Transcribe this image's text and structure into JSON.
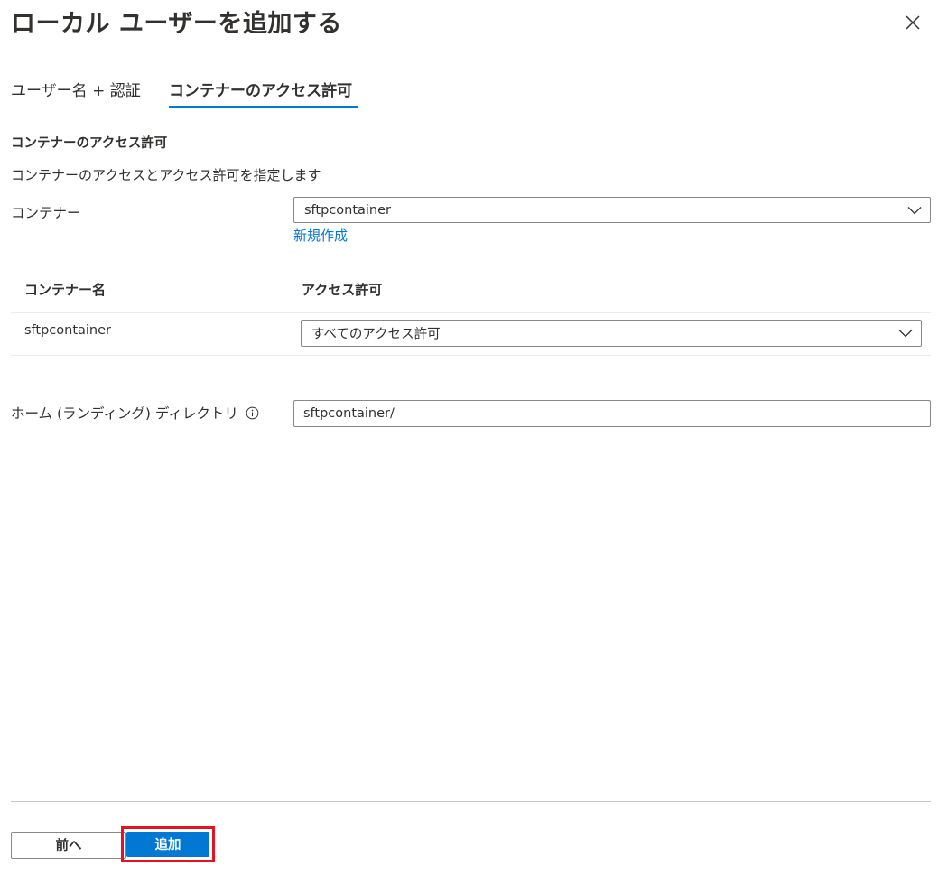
{
  "dialog": {
    "title": "ローカル ユーザーを追加する",
    "close_icon": "close-icon"
  },
  "tabs": [
    {
      "label": "ユーザー名 + 認証",
      "selected": false
    },
    {
      "label": "コンテナーのアクセス許可",
      "selected": true
    }
  ],
  "section": {
    "heading": "コンテナーのアクセス許可",
    "description": "コンテナーのアクセスとアクセス許可を指定します"
  },
  "container_field": {
    "label": "コンテナー",
    "selected_value": "sftpcontainer",
    "create_link": "新規作成"
  },
  "table": {
    "columns": [
      "コンテナー名",
      "アクセス許可"
    ],
    "rows": [
      {
        "name": "sftpcontainer",
        "access": "すべてのアクセス許可"
      }
    ]
  },
  "home_directory": {
    "label": "ホーム (ランディング) ディレクトリ",
    "info_icon": "info-icon",
    "value": "sftpcontainer/"
  },
  "footer": {
    "prev_label": "前へ",
    "add_label": "追加"
  },
  "colors": {
    "accent": "#0078d4",
    "highlight": "#e81123",
    "text": "#323130",
    "border": "#8a8886"
  }
}
